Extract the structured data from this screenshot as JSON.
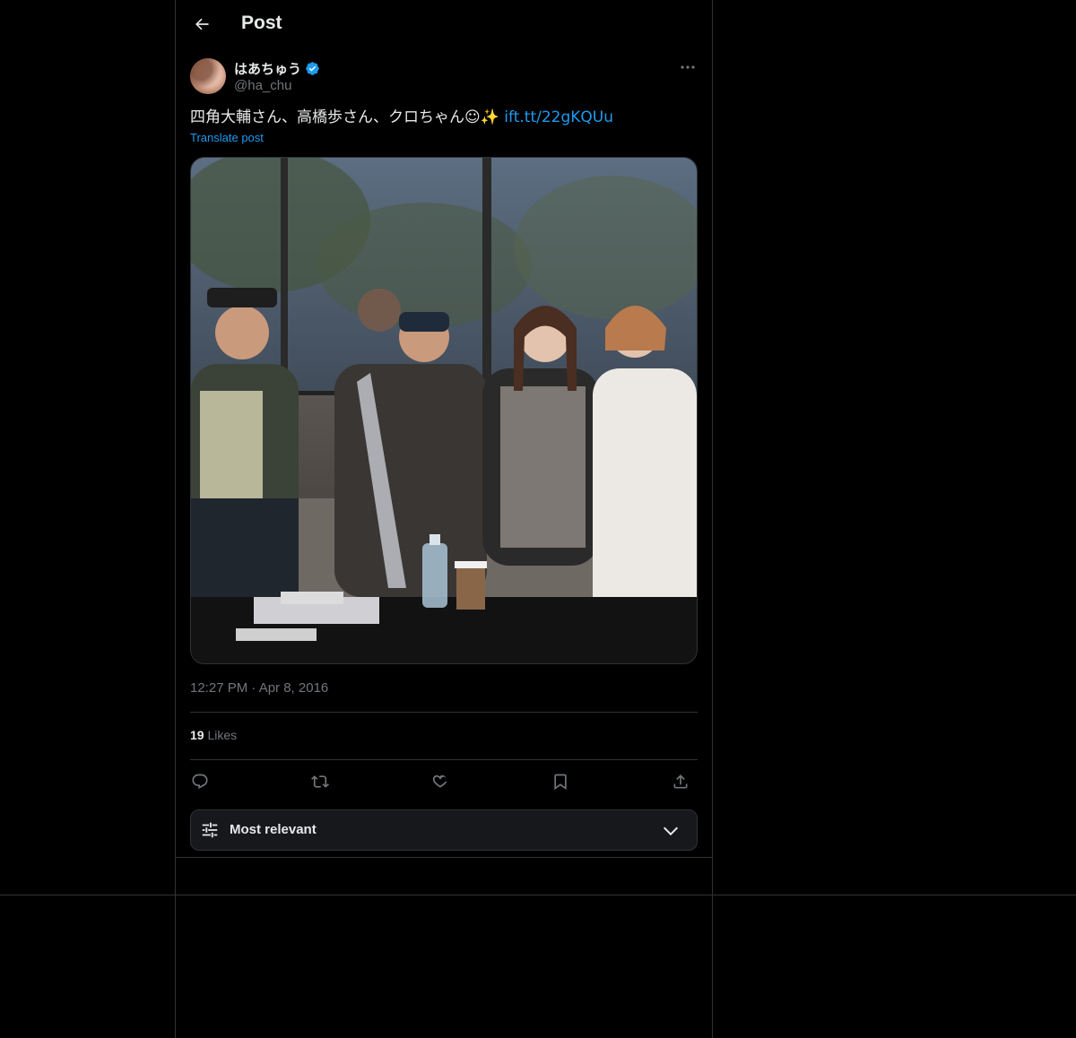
{
  "header": {
    "title": "Post",
    "back_icon": "arrow-left-icon"
  },
  "author": {
    "display_name": "はあちゅう",
    "handle": "@ha_chu",
    "verified": true,
    "verified_color": "#1d9bf0"
  },
  "tweet": {
    "text": "四角大輔さん、高橋歩さん、クロちゃん☺✨ ",
    "link": "ift.tt/22gKQUu",
    "translate_label": "Translate post",
    "timestamp": "12:27 PM · Apr 8, 2016"
  },
  "stats": {
    "likes_count": "19",
    "likes_label": "Likes"
  },
  "actions": [
    "reply-icon",
    "repost-icon",
    "like-icon",
    "bookmark-icon",
    "share-icon"
  ],
  "sort": {
    "label": "Most relevant",
    "icon": "sliders-icon",
    "chevron": "chevron-down-icon"
  },
  "colors": {
    "background": "#000000",
    "text": "#e7e9ea",
    "secondary": "#71767b",
    "accent": "#1d9bf0",
    "border": "#2f3336"
  }
}
